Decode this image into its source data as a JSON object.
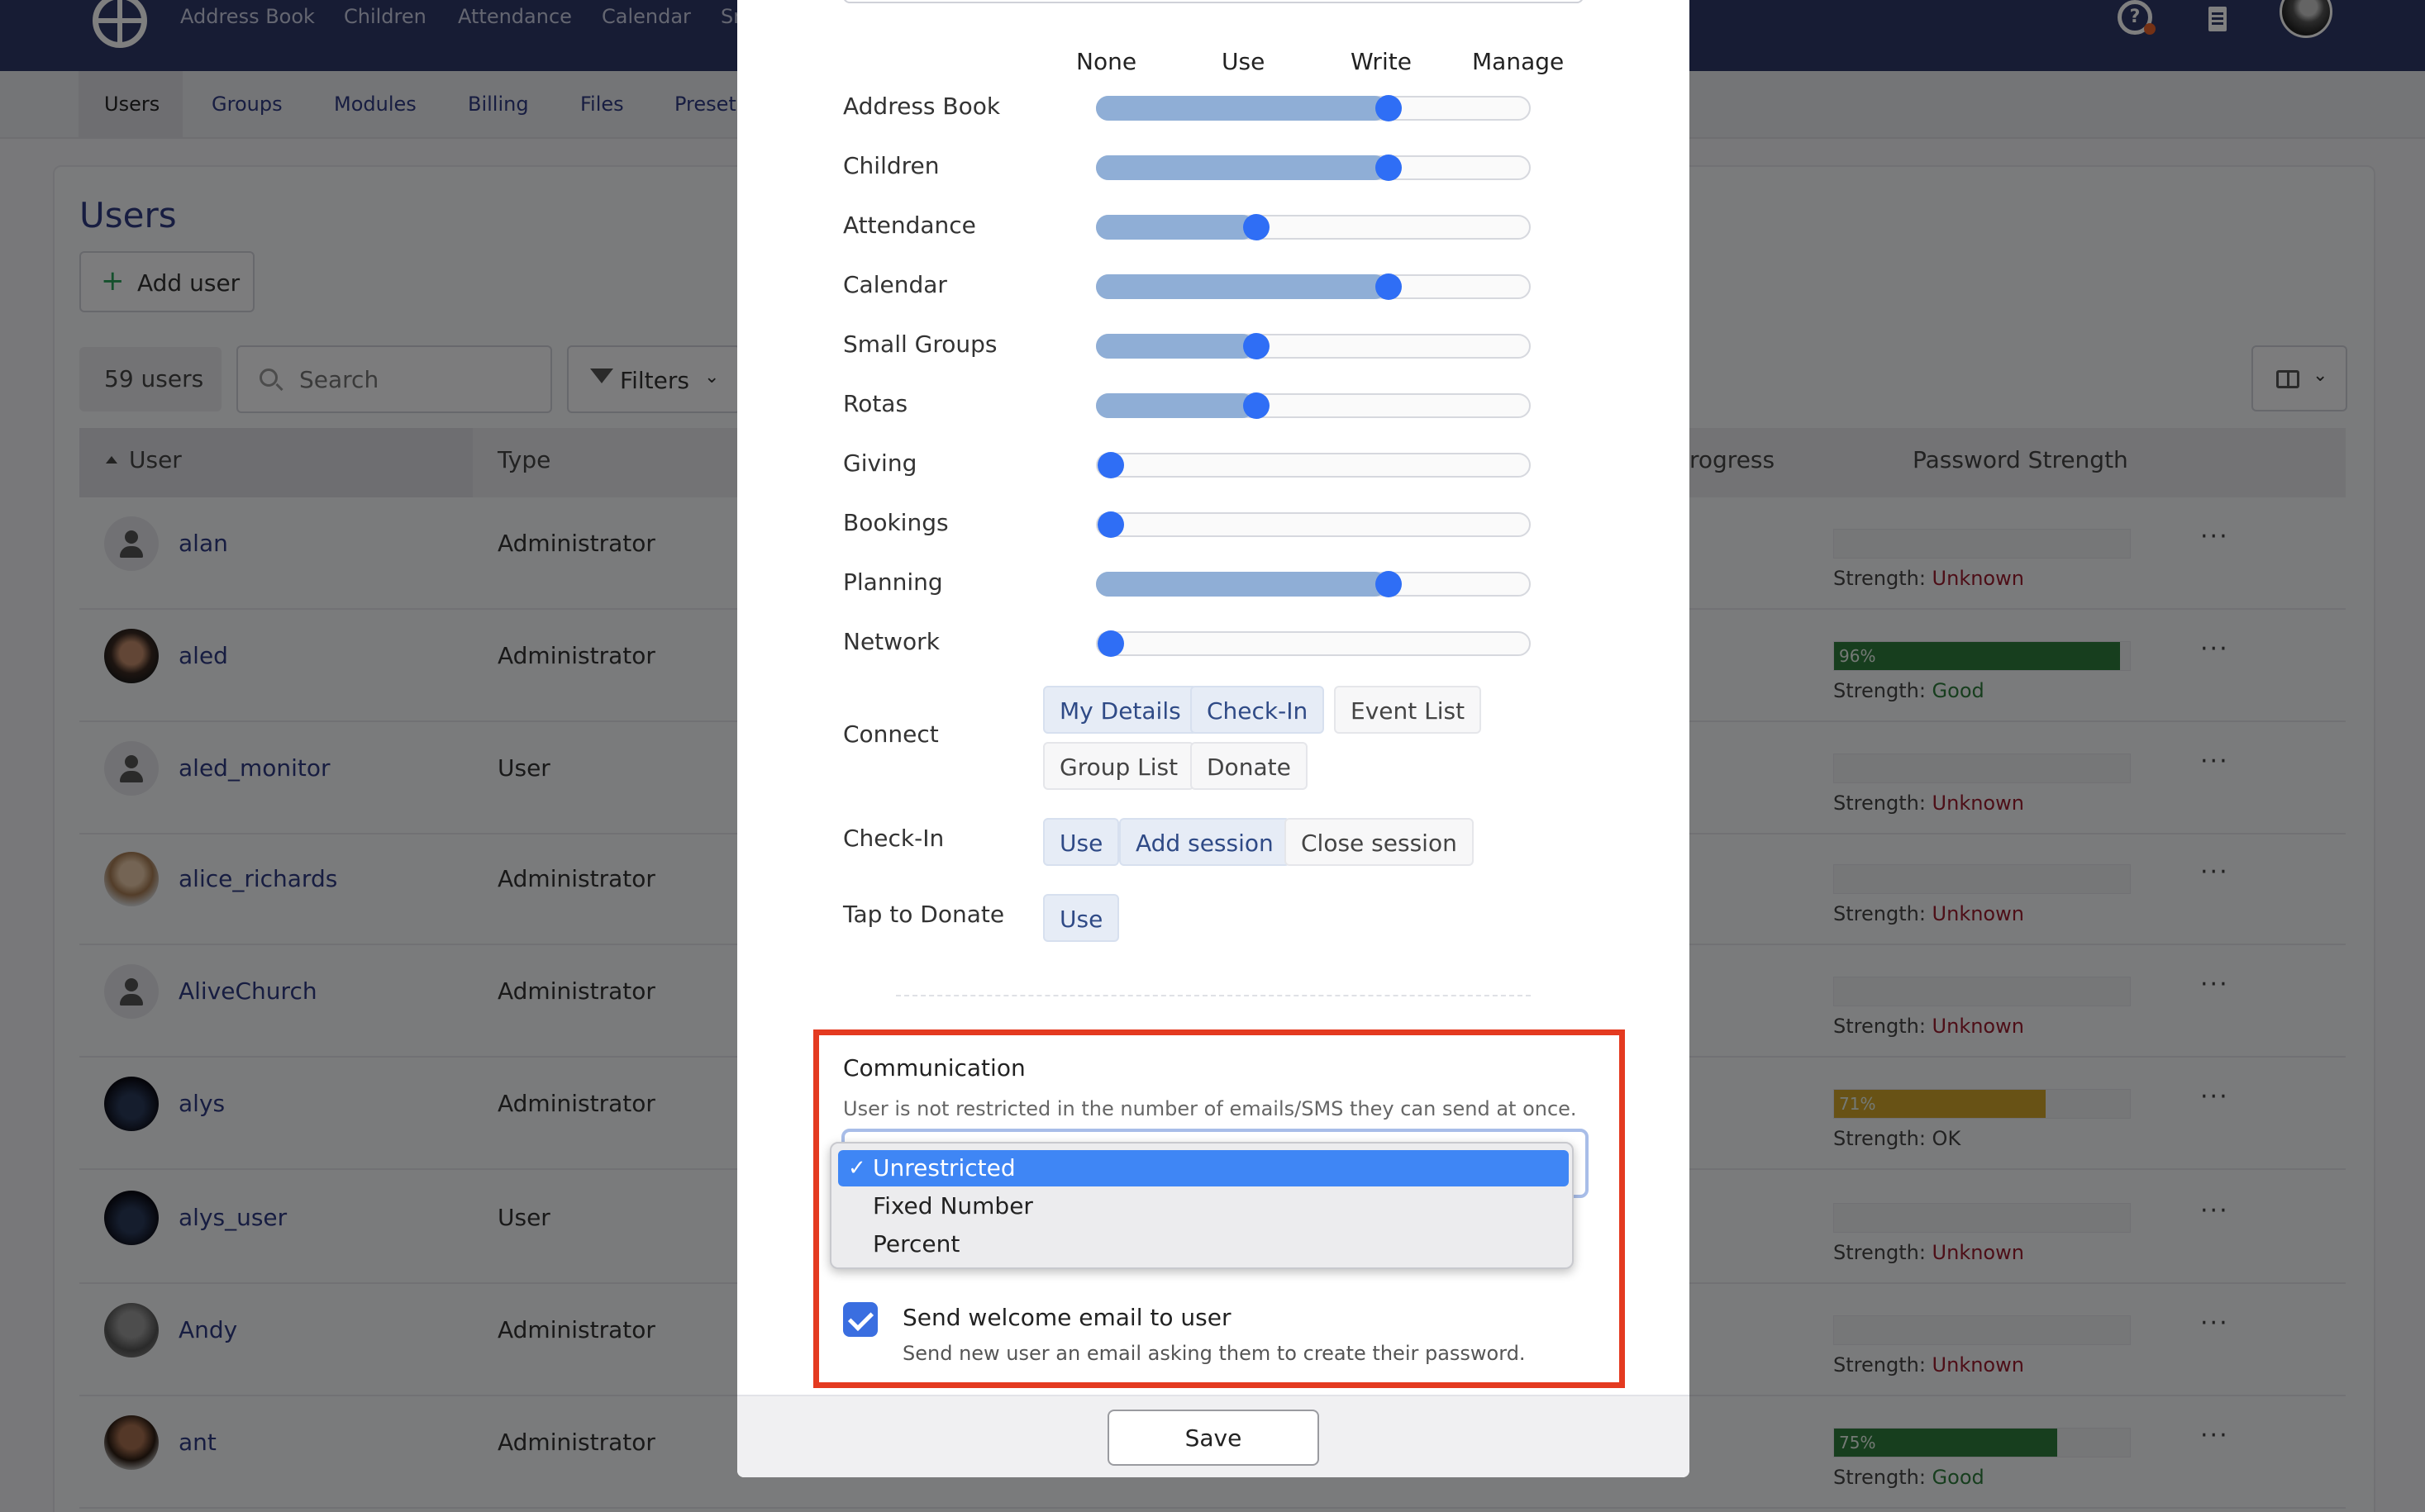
{
  "nav": {
    "items": [
      "Address Book",
      "Children",
      "Attendance",
      "Calendar",
      "Sm"
    ]
  },
  "subnav": {
    "tabs": [
      "Users",
      "Groups",
      "Modules",
      "Billing",
      "Files",
      "Preset"
    ]
  },
  "page": {
    "title": "Users",
    "add_user_label": "Add user",
    "user_count": "59 users",
    "search_placeholder": "Search",
    "filters_label": "Filters"
  },
  "table": {
    "headers": {
      "user": "User",
      "type": "Type",
      "progress": "rogress",
      "password_strength": "Password Strength"
    },
    "strength_prefix": "Strength:",
    "rows": [
      {
        "name": "alan",
        "type": "Administrator",
        "avatar": "default",
        "strength": "Unknown",
        "percent": null
      },
      {
        "name": "aled",
        "type": "Administrator",
        "avatar": "photo",
        "strength": "Good",
        "percent": 96,
        "percent_label": "96%"
      },
      {
        "name": "aled_monitor",
        "type": "User",
        "avatar": "default",
        "strength": "Unknown",
        "percent": null
      },
      {
        "name": "alice_richards",
        "type": "Administrator",
        "avatar": "photo",
        "strength": "Unknown",
        "percent": null
      },
      {
        "name": "AliveChurch",
        "type": "Administrator",
        "avatar": "default",
        "strength": "Unknown",
        "percent": null
      },
      {
        "name": "alys",
        "type": "Administrator",
        "avatar": "photo",
        "strength": "OK",
        "percent": 71,
        "percent_label": "71%"
      },
      {
        "name": "alys_user",
        "type": "User",
        "avatar": "photo",
        "strength": "Unknown",
        "percent": null
      },
      {
        "name": "Andy",
        "type": "Administrator",
        "avatar": "photo",
        "strength": "Unknown",
        "percent": null
      },
      {
        "name": "ant",
        "type": "Administrator",
        "avatar": "photo",
        "strength": "Good",
        "percent": 75,
        "percent_label": "75%"
      }
    ]
  },
  "modal": {
    "levels": [
      "None",
      "Use",
      "Write",
      "Manage"
    ],
    "permissions": [
      {
        "label": "Address Book",
        "level": "Write"
      },
      {
        "label": "Children",
        "level": "Write"
      },
      {
        "label": "Attendance",
        "level": "Use"
      },
      {
        "label": "Calendar",
        "level": "Write"
      },
      {
        "label": "Small Groups",
        "level": "Use"
      },
      {
        "label": "Rotas",
        "level": "Use"
      },
      {
        "label": "Giving",
        "level": "None"
      },
      {
        "label": "Bookings",
        "level": "None"
      },
      {
        "label": "Planning",
        "level": "Write"
      },
      {
        "label": "Network",
        "level": "None"
      }
    ],
    "connect": {
      "label": "Connect",
      "chips": [
        {
          "label": "My Details",
          "on": true
        },
        {
          "label": "Check-In",
          "on": true
        },
        {
          "label": "Event List",
          "on": false
        },
        {
          "label": "Group List",
          "on": false
        },
        {
          "label": "Donate",
          "on": false
        }
      ]
    },
    "checkin": {
      "label": "Check-In",
      "chips": [
        {
          "label": "Use",
          "on": true
        },
        {
          "label": "Add session",
          "on": true
        },
        {
          "label": "Close session",
          "on": false
        }
      ]
    },
    "tap_to_donate": {
      "label": "Tap to Donate",
      "chips": [
        {
          "label": "Use",
          "on": true
        }
      ]
    },
    "communication": {
      "title": "Communication",
      "description": "User is not restricted in the number of emails/SMS they can send at once.",
      "options": [
        "Unrestricted",
        "Fixed Number",
        "Percent"
      ],
      "selected": "Unrestricted",
      "check_glyph": "✓"
    },
    "welcome": {
      "label": "Send welcome email to user",
      "description": "Send new user an email asking them to create their password.",
      "checked": true
    },
    "save_label": "Save"
  },
  "colors": {
    "accent": "#2f6ef5",
    "highlight": "#e43a20",
    "nav_bg": "#2f3869",
    "strength_good": "#2e7d3c",
    "strength_ok": "#d0a42a"
  }
}
